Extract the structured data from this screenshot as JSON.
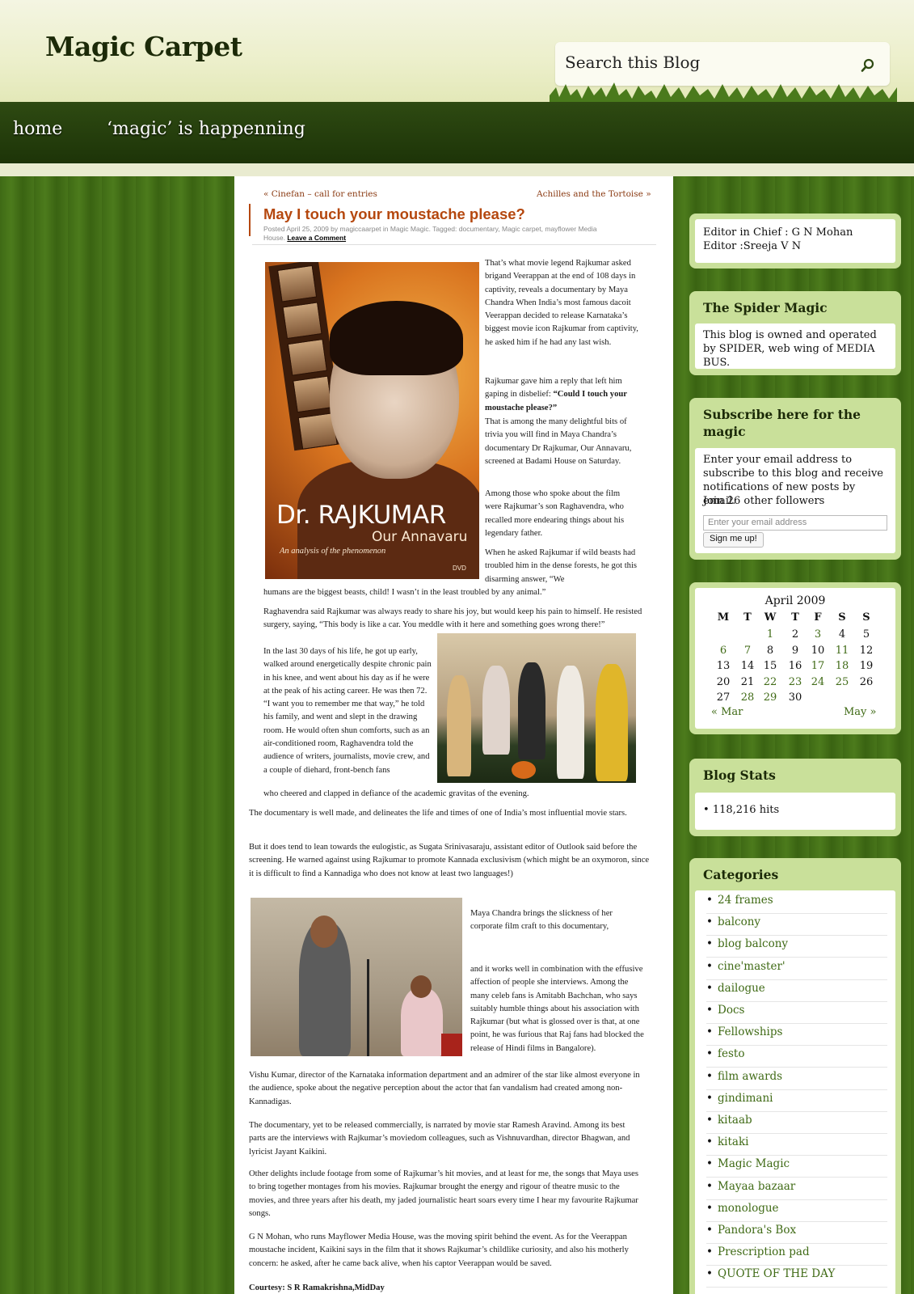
{
  "header": {
    "site_title": "Magic Carpet",
    "search_placeholder": "Search this Blog"
  },
  "nav": {
    "items": [
      {
        "label": "home"
      },
      {
        "label": "‘magic’ is happenning"
      }
    ]
  },
  "post": {
    "prev_link": "« Cinefan – call for entries",
    "next_link": "Achilles and the Tortoise »",
    "title": "May I touch your moustache please?",
    "meta_line1": "Posted April 25, 2009 by magiccaarpet in Magic Magic. Tagged: documentary, Magic carpet, mayflower Media",
    "meta_line2_prefix": "House.",
    "meta_comment": "Leave a Comment",
    "dvd": {
      "title": "Dr. RAJKUMAR",
      "subtitle": "Our Annavaru",
      "tagline": "An analysis of the phenomenon",
      "label": "DVD"
    },
    "p1": "That’s what movie legend Rajkumar asked brigand Veerappan at the end of 108 days in captivity, reveals a documentary by Maya Chandra When India’s most famous dacoit Veerappan decided to release Karnataka’s biggest movie icon Rajkumar from captivity, he asked him if he had any last wish.",
    "p2_intro": "Rajkumar gave him a reply that left him gaping in disbelief: ",
    "p2_bold": "“Could I touch your moustache please?”",
    "p3": "That is among the many delightful bits of trivia you will find in Maya Chandra’s documentary Dr Rajkumar, Our Annavaru, screened at Badami House on Saturday.",
    "p4": "Among those who spoke about the film were Rajkumar’s son Raghavendra, who recalled more endearing things about his legendary father.",
    "p5": "When he asked Rajkumar if wild beasts had troubled him in the dense forests, he got this disarming answer, “We",
    "p5_cont": "humans are the biggest beasts, child! I wasn’t in the least troubled by any animal.”",
    "p6": "Raghavendra said Rajkumar was always ready to share his joy, but would keep his pain to himself. He resisted surgery, saying, “This body is like a car. You meddle with it here and something goes wrong there!”",
    "p7": "In the last 30 days of his life, he got up early, walked around energetically despite chronic pain in his knee, and went about his day as if he were at the peak of his acting career. He was then 72. “I want you to remember me that way,” he told his family, and went and slept in the drawing room. He would often shun comforts, such as an air-conditioned room, Raghavendra told the audience of writers, journalists, movie crew, and a couple of diehard, front-bench fans",
    "p7_cont": "who cheered and clapped in defiance of the academic gravitas of the evening.",
    "p8": "The documentary is well made, and delineates the life and times of one of India’s most influential movie stars.",
    "p9": "But it does tend to lean towards the eulogistic, as Sugata Srinivasaraju, assistant editor of Outlook said before the screening. He warned against using Rajkumar to promote Kannada exclusivism (which might be an oxymoron, since it is difficult to find a Kannadiga who does not know at least two languages!)",
    "p10": "Maya Chandra brings the slickness of her corporate film craft to this documentary,",
    "p11": "and it works well in combination with the effusive affection of people she interviews. Among the many celeb fans is Amitabh Bachchan, who says suitably humble things about his association with Rajkumar (but what is glossed over is that, at one point, he was furious that Raj fans had blocked the release of Hindi films in Bangalore).",
    "p12": "Vishu Kumar, director of the Karnataka information department and an admirer of the star like almost everyone in the audience, spoke about the negative perception about the actor that fan vandalism had created among non-Kannadigas.",
    "p13": "The documentary, yet to be released commercially, is narrated by movie star Ramesh Aravind. Among its best parts are the interviews with Rajkumar’s moviedom colleagues, such as Vishnuvardhan, director Bhagwan, and lyricist Jayant Kaikini.",
    "p14": "Other delights include footage from some of Rajkumar’s hit movies, and at least for me, the songs that Maya uses to bring together montages from his movies. Rajkumar brought the energy and rigour of theatre music to the movies, and three years after his death, my jaded journalistic heart soars every time I hear my favourite Rajkumar songs.",
    "p15": "G N Mohan, who runs Mayflower Media House, was the moving spirit behind the event. As for the Veerappan moustache incident, Kaikini says in the film that it shows Rajkumar’s childlike curiosity, and also his motherly concern: he asked, after he came back alive, when his captor Veerappan would be saved.",
    "courtesy": "Courtesy: S R Ramakrishna,MidDay"
  },
  "sidebar": {
    "editor": {
      "text": "Editor in Chief : G N Mohan Editor :Sreeja V N"
    },
    "spider": {
      "title": "The Spider Magic",
      "text": "This blog is owned and operated by SPIDER, web wing of MEDIA BUS."
    },
    "subscribe": {
      "title": "Subscribe here for the magic",
      "text": "Enter your email address to subscribe to this blog and receive notifications of new posts by email.",
      "followers": "Join 26 other followers",
      "email_placeholder": "Enter your email address",
      "button": "Sign me up!"
    },
    "calendar": {
      "caption": "April 2009",
      "headers": [
        "M",
        "T",
        "W",
        "T",
        "F",
        "S",
        "S"
      ],
      "weeks": [
        [
          "",
          "",
          "1",
          "2",
          "3",
          "4",
          "5"
        ],
        [
          "6",
          "7",
          "8",
          "9",
          "10",
          "11",
          "12"
        ],
        [
          "13",
          "14",
          "15",
          "16",
          "17",
          "18",
          "19"
        ],
        [
          "20",
          "21",
          "22",
          "23",
          "24",
          "25",
          "26"
        ],
        [
          "27",
          "28",
          "29",
          "30",
          "",
          "",
          ""
        ]
      ],
      "linked_days": [
        "1",
        "3",
        "6",
        "7",
        "11",
        "17",
        "18",
        "22",
        "23",
        "24",
        "25",
        "28",
        "29"
      ],
      "prev": "« Mar",
      "next": "May »"
    },
    "stats": {
      "title": "Blog Stats",
      "hits": "118,216 hits"
    },
    "categories": {
      "title": "Categories",
      "items": [
        "24 frames",
        "balcony",
        "blog balcony",
        "cine'master'",
        "dailogue",
        "Docs",
        "Fellowships",
        "festo",
        "film awards",
        "gindimani",
        "kitaab",
        "kitaki",
        "Magic Magic",
        "Mayaa bazaar",
        "monologue",
        "Pandora's Box",
        "Prescription pad",
        "QUOTE OF THE DAY"
      ]
    }
  }
}
